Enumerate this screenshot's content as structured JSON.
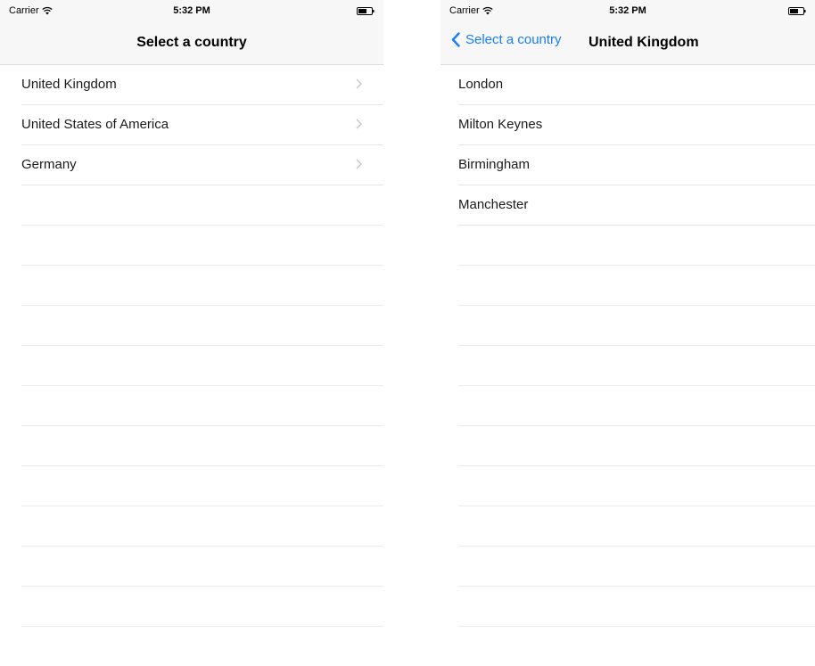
{
  "left_screen": {
    "status": {
      "carrier": "Carrier",
      "wifi_icon": "wifi-icon",
      "time": "5:32 PM",
      "battery_icon": "battery-icon"
    },
    "nav": {
      "title": "Select a country"
    },
    "rows": [
      {
        "label": "United Kingdom",
        "icon": "chevron-right-icon"
      },
      {
        "label": "United States of America",
        "icon": "chevron-right-icon"
      },
      {
        "label": "Germany",
        "icon": "chevron-right-icon"
      }
    ]
  },
  "right_screen": {
    "status": {
      "carrier": "Carrier",
      "wifi_icon": "wifi-icon",
      "time": "5:32 PM",
      "battery_icon": "battery-icon"
    },
    "nav": {
      "back_label": "Select a country",
      "back_icon": "chevron-left-icon",
      "title": "United Kingdom"
    },
    "rows": [
      {
        "label": "London"
      },
      {
        "label": "Milton Keynes"
      },
      {
        "label": "Birmingham"
      },
      {
        "label": "Manchester"
      }
    ]
  },
  "colors": {
    "tint": "#157efb",
    "bar_background": "#f7f7f7",
    "separator": "#e6e6e6"
  }
}
